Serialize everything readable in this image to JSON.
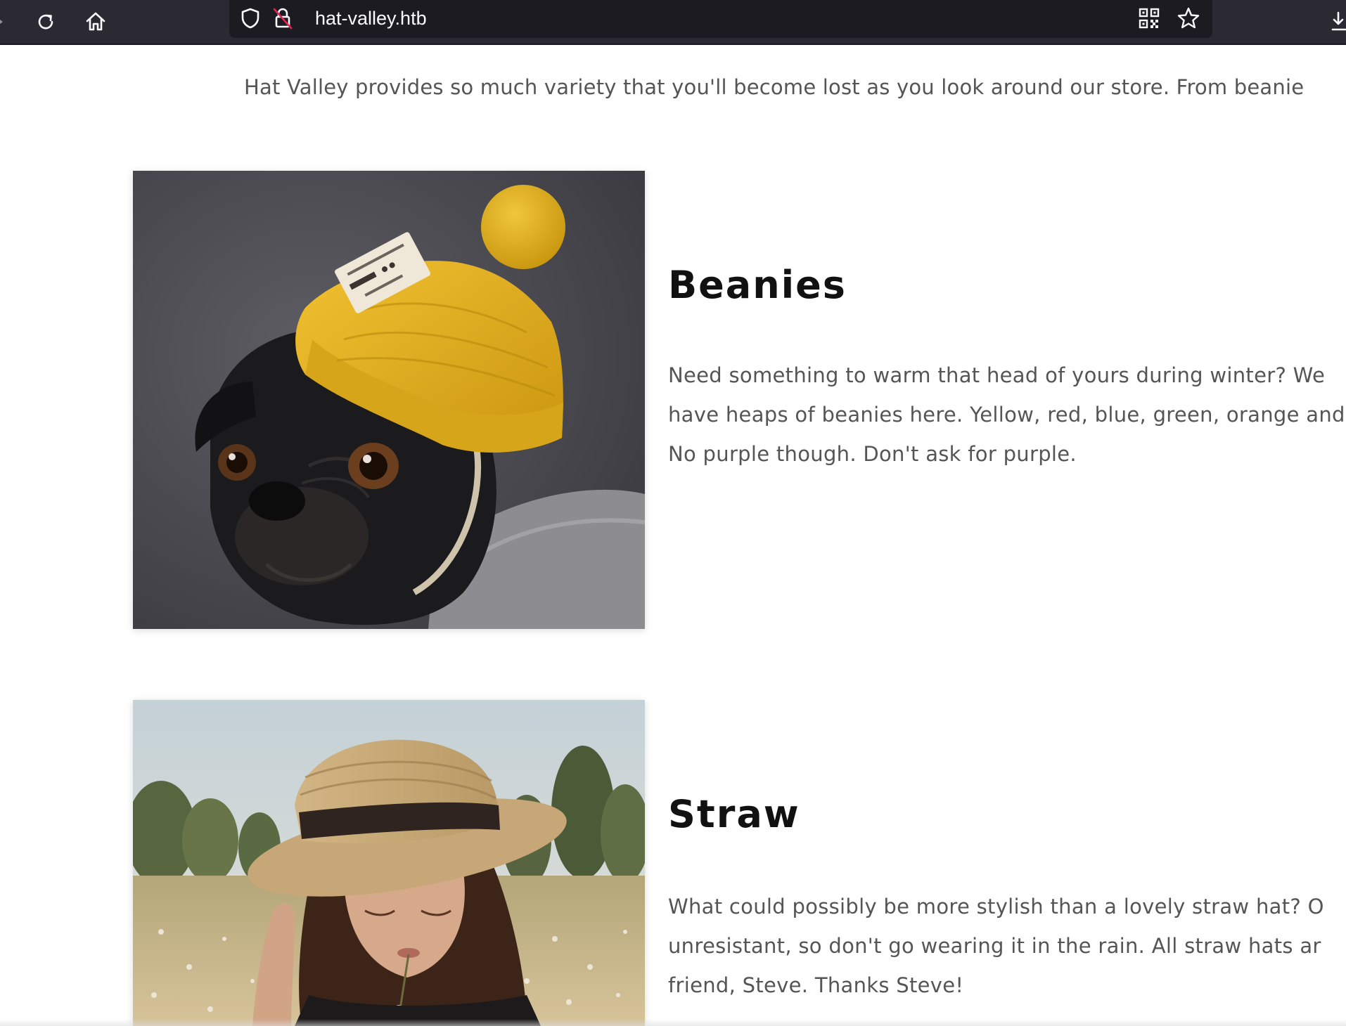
{
  "browser": {
    "url": "hat-valley.htb",
    "icons": {
      "back": "back-arrow-icon",
      "reload": "reload-icon",
      "home": "home-icon",
      "tracking": "shield-icon",
      "connection": "insecure-lock-icon",
      "qr": "qr-code-icon",
      "bookmark": "star-icon",
      "downloads": "download-icon"
    }
  },
  "page": {
    "intro": "Hat Valley provides so much variety that you'll become lost as you look around our store. From beanie",
    "products": [
      {
        "title": "Beanies",
        "image_alt": "pug-wearing-yellow-beanie",
        "description": [
          "Need something to warm that head of yours during winter? We",
          "have heaps of beanies here. Yellow, red, blue, green, orange and",
          "No purple though. Don't ask for purple."
        ]
      },
      {
        "title": "Straw",
        "image_alt": "woman-wearing-straw-hat",
        "description": [
          "What could possibly be more stylish than a lovely straw hat? O",
          "unresistant, so don't go wearing it in the rain. All straw hats ar",
          "friend, Steve. Thanks Steve!"
        ]
      }
    ]
  },
  "colors": {
    "toolbar_bg": "#2b2a33",
    "urlbar_bg": "#1c1b22",
    "heading": "#111111",
    "body_text": "#555555",
    "beanie_yellow": "#e0b21c"
  }
}
